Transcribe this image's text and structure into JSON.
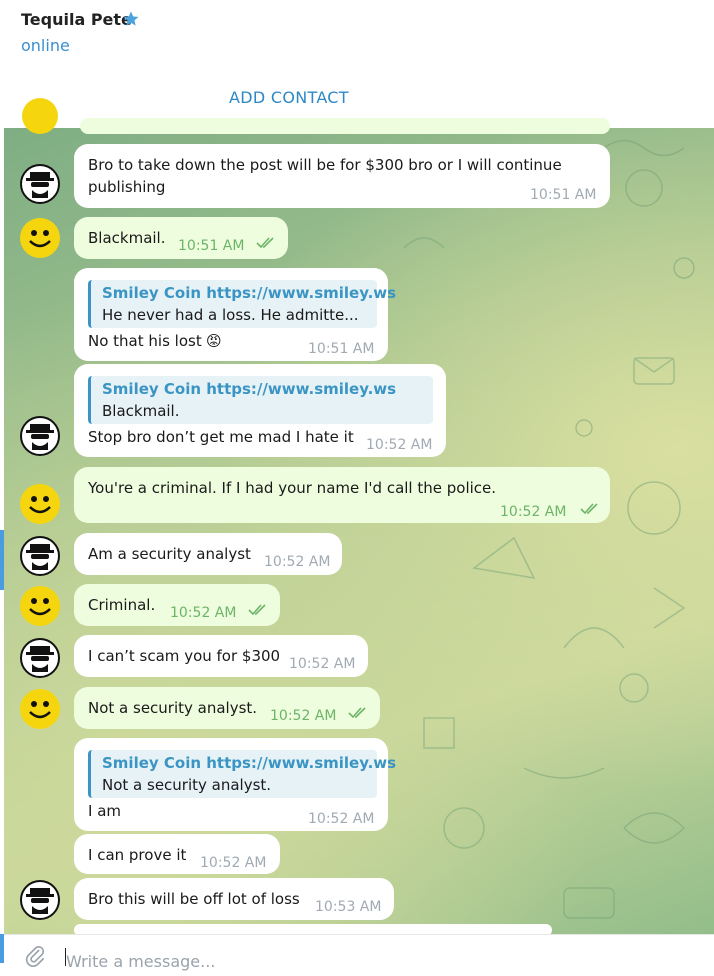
{
  "header": {
    "name": "Tequila Pete",
    "status": "online"
  },
  "add_contact": "ADD CONTACT",
  "messages": [
    {
      "text1": "Bro to take down the post will be for $300 bro or I will continue",
      "text2": "publishing",
      "time": "10:51 AM"
    },
    {
      "text": "Blackmail.",
      "time": "10:51 AM"
    },
    {
      "quote_title": "Smiley Coin https://www.smiley.ws",
      "quote_text": "He never had a loss.  He admitte...",
      "text": "No that his lost",
      "emoji": "😡",
      "time": "10:51 AM"
    },
    {
      "quote_title": "Smiley Coin https://www.smiley.ws",
      "quote_text": "Blackmail.",
      "text": "Stop bro don’t get me mad I hate it",
      "time": "10:52 AM"
    },
    {
      "text": "You're a criminal.  If I had your name I'd call the police.",
      "time": "10:52 AM"
    },
    {
      "text": "Am a security analyst",
      "time": "10:52 AM"
    },
    {
      "text": "Criminal.",
      "time": "10:52 AM"
    },
    {
      "text": "I can’t scam you for $300",
      "time": "10:52 AM"
    },
    {
      "text": "Not a security analyst.",
      "time": "10:52 AM"
    },
    {
      "quote_title": "Smiley Coin https://www.smiley.ws",
      "quote_text": "Not a security analyst.",
      "text": "I am",
      "time": "10:52 AM"
    },
    {
      "text": "I can prove it",
      "time": "10:52 AM"
    },
    {
      "text": "Bro this will be off lot of loss",
      "time": "10:53 AM"
    }
  ],
  "composer": {
    "placeholder": "Write a message..."
  }
}
